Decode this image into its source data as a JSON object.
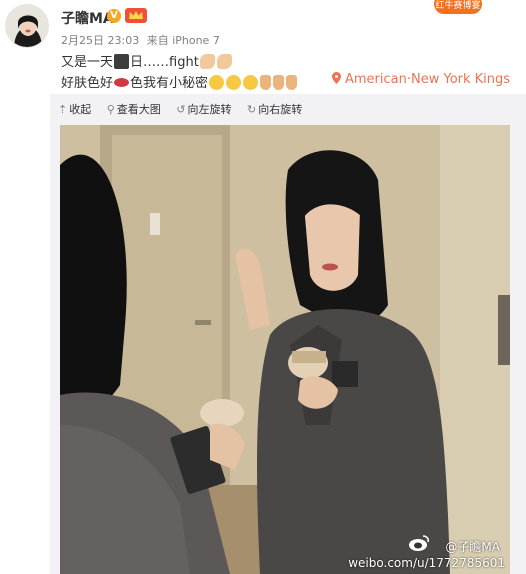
{
  "post": {
    "username": "子瞻MA",
    "vip_badge": "V",
    "corner_badge": "红牛赛博宴",
    "date": "2月25日 23:03",
    "source": "来自 iPhone 7",
    "line1": {
      "before": "又是一天",
      "mid": "日……fight",
      "emojis": [
        "clapper-board",
        "flexed-arm",
        "flexed-arm"
      ]
    },
    "line2": {
      "part1": "好肤色好",
      "part2": "色我有小秘密",
      "emojis": [
        "lips",
        "sleepy-face",
        "sleepy-face",
        "sleepy-face",
        "pointing-down",
        "pointing-down",
        "pointing-down"
      ]
    },
    "location": "American·New York Kings"
  },
  "toolbar": {
    "collapse": "收起",
    "view_large": "查看大图",
    "rotate_left": "向左旋转",
    "rotate_right": "向右旋转"
  },
  "photo": {
    "watermark_account": "@子瞻MA",
    "watermark_url": "weibo.com/u/1772785601"
  },
  "colors": {
    "link_orange": "#eb7350",
    "meta_gray": "#808080",
    "panel_bg": "#f2f2f5"
  }
}
